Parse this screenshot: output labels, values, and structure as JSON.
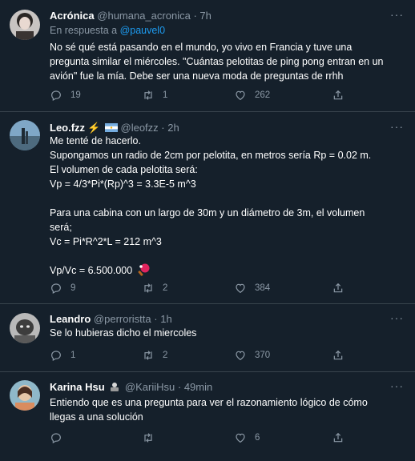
{
  "tweets": [
    {
      "name": "Acrónica",
      "handle": "@humana_acronica",
      "time": "7h",
      "reply_prefix": "En respuesta a ",
      "reply_handle": "@pauvel0",
      "lines": [
        "No sé qué está pasando en el mundo, yo vivo en Francia y tuve una",
        "pregunta similar el miércoles. \"Cuántas pelotitas de ping pong entran en un",
        "avión\" fue la mía. Debe ser una nueva moda de preguntas de rrhh"
      ],
      "replies": "19",
      "retweets": "1",
      "likes": "262"
    },
    {
      "name": "Leo.fzz",
      "handle": "@leofzz",
      "time": "2h",
      "lines": [
        "Me tenté de hacerlo.",
        "Supongamos un radio de 2cm por pelotita, en metros sería Rp = 0.02 m.",
        "El volumen de cada pelotita será:",
        "Vp = 4/3*Pi*(Rp)^3 = 3.3E-5 m^3",
        "",
        "Para una cabina con un largo de 30m y un diámetro de 3m, el volumen",
        "será;",
        "Vc = Pi*R^2*L = 212 m^3",
        "",
        "Vp/Vc = 6.500.000"
      ],
      "replies": "9",
      "retweets": "2",
      "likes": "384"
    },
    {
      "name": "Leandro",
      "handle": "@perroristta",
      "time": "1h",
      "lines": [
        "Se lo hubieras dicho el miercoles"
      ],
      "replies": "1",
      "retweets": "2",
      "likes": "370"
    },
    {
      "name": "Karina Hsu",
      "handle": "@KariiHsu",
      "time": "49min",
      "lines": [
        "Entiendo que es una pregunta para ver el razonamiento lógico de cómo",
        "llegas a una solución"
      ],
      "replies": "",
      "retweets": "",
      "likes": "6"
    }
  ],
  "more_glyph": "···",
  "dot": "·",
  "icons": [
    "reply-icon",
    "retweet-icon",
    "like-icon",
    "share-icon",
    "more-icon",
    "ping-pong-icon",
    "lightning-icon",
    "argentina-flag-icon"
  ],
  "colors": {
    "background": "#15202b",
    "text": "#ffffff",
    "muted": "#8b98a5",
    "link": "#1d9bf0",
    "divider": "#38444d"
  }
}
